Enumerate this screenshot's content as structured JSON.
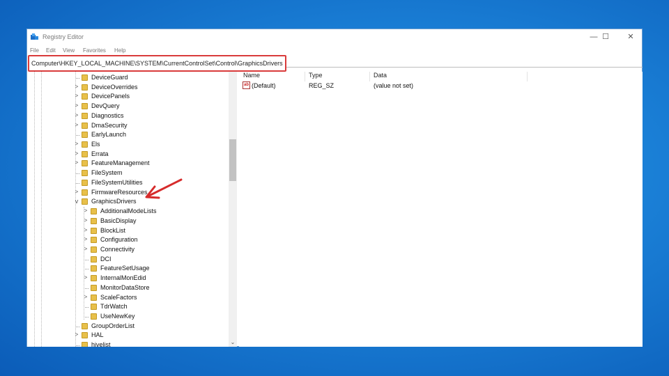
{
  "window": {
    "title": "Registry Editor",
    "controls": {
      "minimize": "—",
      "maximize": "☐",
      "close": "✕"
    }
  },
  "menu": [
    "File",
    "Edit",
    "View",
    "Favorites",
    "Help"
  ],
  "address": "Computer\\HKEY_LOCAL_MACHINE\\SYSTEM\\CurrentControlSet\\Control\\GraphicsDrivers",
  "tree": [
    {
      "label": "DeviceGuard",
      "level": 0,
      "expander": ""
    },
    {
      "label": "DeviceOverrides",
      "level": 0,
      "expander": ">"
    },
    {
      "label": "DevicePanels",
      "level": 0,
      "expander": ">"
    },
    {
      "label": "DevQuery",
      "level": 0,
      "expander": ">"
    },
    {
      "label": "Diagnostics",
      "level": 0,
      "expander": ">"
    },
    {
      "label": "DmaSecurity",
      "level": 0,
      "expander": ">"
    },
    {
      "label": "EarlyLaunch",
      "level": 0,
      "expander": ""
    },
    {
      "label": "Els",
      "level": 0,
      "expander": ">"
    },
    {
      "label": "Errata",
      "level": 0,
      "expander": ">"
    },
    {
      "label": "FeatureManagement",
      "level": 0,
      "expander": ">"
    },
    {
      "label": "FileSystem",
      "level": 0,
      "expander": ""
    },
    {
      "label": "FileSystemUtilities",
      "level": 0,
      "expander": ""
    },
    {
      "label": "FirmwareResources",
      "level": 0,
      "expander": ">"
    },
    {
      "label": "GraphicsDrivers",
      "level": 0,
      "expander": "v"
    },
    {
      "label": "AdditionalModeLists",
      "level": 1,
      "expander": ">"
    },
    {
      "label": "BasicDisplay",
      "level": 1,
      "expander": ">"
    },
    {
      "label": "BlockList",
      "level": 1,
      "expander": ">"
    },
    {
      "label": "Configuration",
      "level": 1,
      "expander": ">"
    },
    {
      "label": "Connectivity",
      "level": 1,
      "expander": ">"
    },
    {
      "label": "DCI",
      "level": 1,
      "expander": ""
    },
    {
      "label": "FeatureSetUsage",
      "level": 1,
      "expander": ""
    },
    {
      "label": "InternalMonEdid",
      "level": 1,
      "expander": ">"
    },
    {
      "label": "MonitorDataStore",
      "level": 1,
      "expander": ""
    },
    {
      "label": "ScaleFactors",
      "level": 1,
      "expander": ">"
    },
    {
      "label": "TdrWatch",
      "level": 1,
      "expander": ""
    },
    {
      "label": "UseNewKey",
      "level": 1,
      "expander": ""
    },
    {
      "label": "GroupOrderList",
      "level": 0,
      "expander": ""
    },
    {
      "label": "HAL",
      "level": 0,
      "expander": ">"
    },
    {
      "label": "hivelist",
      "level": 0,
      "expander": ""
    }
  ],
  "columns": {
    "name": "Name",
    "type": "Type",
    "data": "Data"
  },
  "values": [
    {
      "icon": "ab",
      "name": "(Default)",
      "type": "REG_SZ",
      "data": "(value not set)"
    }
  ],
  "colors": {
    "highlight": "#d93b3b",
    "folder": "#e8c04a",
    "desktop": "#1a7fd6"
  }
}
